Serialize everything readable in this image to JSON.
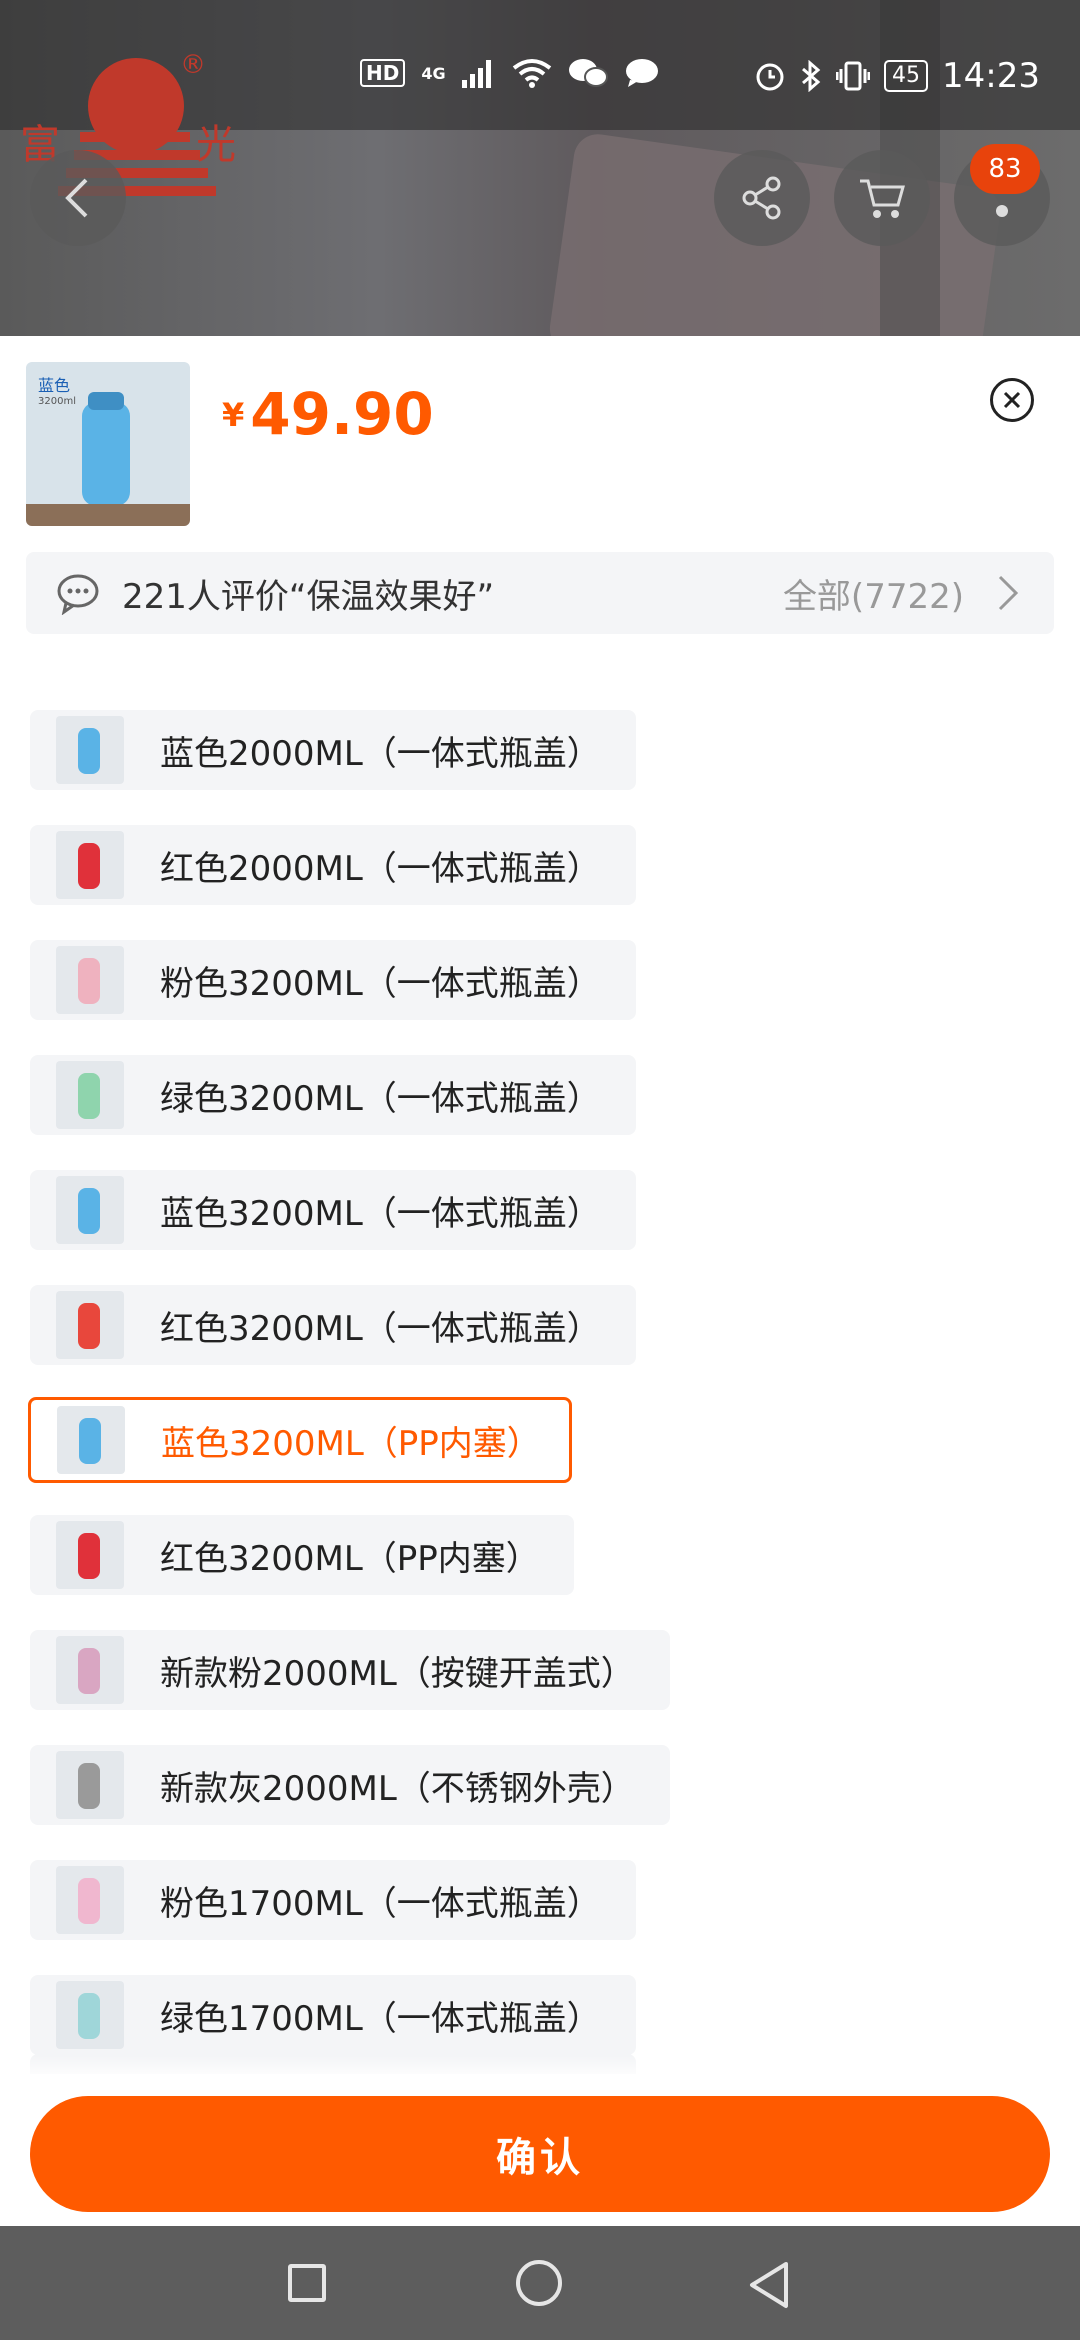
{
  "status_bar": {
    "network": "HD",
    "signal": "4G",
    "battery": "45",
    "time": "14:23"
  },
  "brand_logo": {
    "left_char": "富",
    "right_char": "光",
    "reg_mark": "®"
  },
  "header": {
    "badge_count": "83"
  },
  "product": {
    "thumbnail_label": "蓝色",
    "thumbnail_sub": "3200ml",
    "currency": "¥",
    "price": "49.90"
  },
  "review": {
    "text": "221人评价“保温效果好”",
    "all_label": "全部(7722)"
  },
  "options": [
    {
      "label": "蓝色2000ML（一体式瓶盖）",
      "color": "#5ab3e6",
      "selected": false
    },
    {
      "label": "红色2000ML（一体式瓶盖）",
      "color": "#e0313a",
      "selected": false
    },
    {
      "label": "粉色3200ML（一体式瓶盖）",
      "color": "#efb2bf",
      "selected": false
    },
    {
      "label": "绿色3200ML（一体式瓶盖）",
      "color": "#8fd4ad",
      "selected": false
    },
    {
      "label": "蓝色3200ML（一体式瓶盖）",
      "color": "#5ab3e6",
      "selected": false
    },
    {
      "label": "红色3200ML（一体式瓶盖）",
      "color": "#e8473c",
      "selected": false
    },
    {
      "label": "蓝色3200ML（PP内塞）",
      "color": "#5ab3e6",
      "selected": true
    },
    {
      "label": "红色3200ML（PP内塞）",
      "color": "#e0313a",
      "selected": false
    },
    {
      "label": "新款粉2000ML（按键开盖式）",
      "color": "#d9a6c2",
      "selected": false
    },
    {
      "label": "新款灰2000ML（不锈钢外壳）",
      "color": "#9a9a9a",
      "selected": false
    },
    {
      "label": "粉色1700ML（一体式瓶盖）",
      "color": "#f0b7cf",
      "selected": false
    },
    {
      "label": "绿色1700ML（一体式瓶盖）",
      "color": "#9fd6d9",
      "selected": false
    }
  ],
  "confirm_label": "确认",
  "colors": {
    "accent": "#ff5a00",
    "option_bg": "#f4f5f7"
  }
}
